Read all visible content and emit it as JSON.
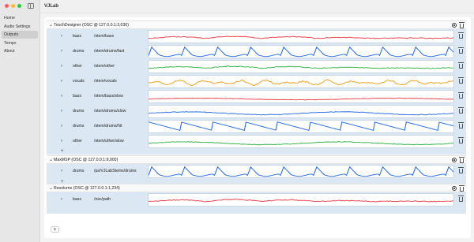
{
  "window": {
    "title": "VJLab"
  },
  "sidebar": {
    "items": [
      {
        "label": "Home"
      },
      {
        "label": "Audio Settings"
      },
      {
        "label": "Outputs",
        "active": true
      },
      {
        "label": "Tempo"
      },
      {
        "label": "About"
      }
    ]
  },
  "groups": [
    {
      "title": "TouchDesigner  (OSC @ 127.0.0.1:3,030)",
      "rows": [
        {
          "stem": "bass",
          "path": "/stem/bass",
          "color": "#e8424a",
          "wave": "wobble"
        },
        {
          "stem": "drums",
          "path": "/stem/drums/fast",
          "color": "#2a6fe0",
          "wave": "spikes"
        },
        {
          "stem": "other",
          "path": "/stem/other",
          "color": "#32b44a",
          "wave": "wobble"
        },
        {
          "stem": "vocals",
          "path": "/stem/vocals",
          "color": "#f0a020",
          "wave": "busy"
        },
        {
          "stem": "bass",
          "path": "/stem/bass/slow",
          "color": "#e8424a",
          "wave": "flat"
        },
        {
          "stem": "drums",
          "path": "/stem/drums/slow",
          "color": "#2a6fe0",
          "wave": "gentle"
        },
        {
          "stem": "drums",
          "path": "/stem/drums/hit",
          "color": "#2a6fe0",
          "wave": "saw"
        },
        {
          "stem": "other",
          "path": "/stem/other/slow",
          "color": "#32b44a",
          "wave": "gentle"
        }
      ],
      "add_label": "+"
    },
    {
      "title": "MaxMSP  (OSC @ 127.0.0.1:8,000)",
      "rows": [
        {
          "stem": "drums",
          "path": "/ps/VJLabStems/drums",
          "color": "#2a6fe0",
          "wave": "spikes"
        }
      ],
      "add_label": "+"
    },
    {
      "title": "Resolume  (OSC @ 127.0.0.1:1,234)",
      "rows": [
        {
          "stem": "bass",
          "path": "/osc/path",
          "color": "#e8424a",
          "wave": "wobble"
        }
      ],
      "add_label": "+"
    }
  ],
  "footer": {
    "add_label": "+"
  },
  "icons": {
    "chevron_right": "›",
    "chevron_down": "⌄"
  }
}
